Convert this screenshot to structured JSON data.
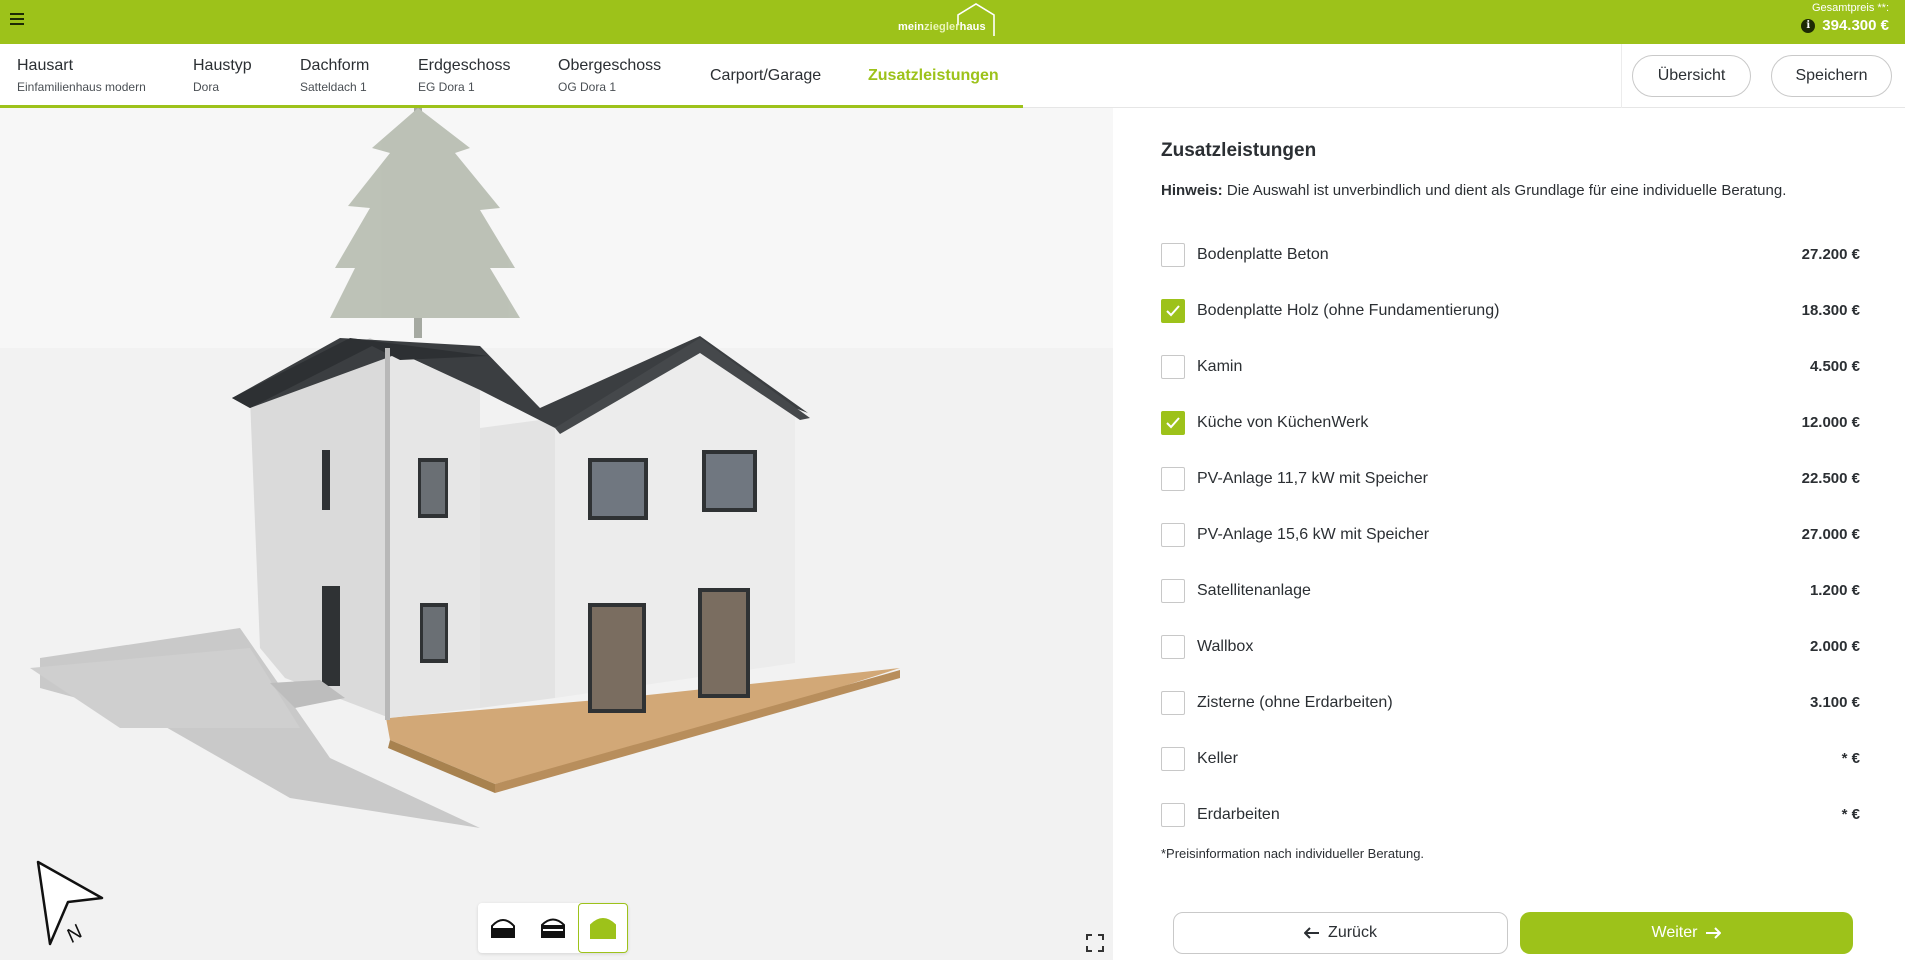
{
  "header": {
    "logo": {
      "part1": "mein",
      "part2": "ziegler",
      "part3": "haus"
    },
    "price_label": "Gesamtpreis **:",
    "price_value": "394.300 €",
    "info_icon": "info-icon",
    "menu_icon": "hamburger-menu-icon"
  },
  "nav": {
    "steps": [
      {
        "title": "Hausart",
        "sub": "Einfamilienhaus modern"
      },
      {
        "title": "Haustyp",
        "sub": "Dora"
      },
      {
        "title": "Dachform",
        "sub": "Satteldach 1"
      },
      {
        "title": "Erdgeschoss",
        "sub": "EG Dora 1"
      },
      {
        "title": "Obergeschoss",
        "sub": "OG Dora 1"
      },
      {
        "title": "Carport/Garage",
        "sub": ""
      },
      {
        "title": "Zusatzleistungen",
        "sub": "",
        "active": true
      }
    ],
    "overview_label": "Übersicht",
    "save_label": "Speichern"
  },
  "viewer": {
    "view_modes": [
      "floor-plan-view-icon",
      "section-view-icon",
      "house-3d-view-icon"
    ],
    "active_view": 2,
    "fullscreen_icon": "fullscreen-icon",
    "compass_label": "N"
  },
  "panel": {
    "title": "Zusatzleistungen",
    "hint_label": "Hinweis:",
    "hint_text": " Die Auswahl ist unverbindlich und dient als Grundlage für eine individuelle Beratung.",
    "options": [
      {
        "label": "Bodenplatte Beton",
        "price": "27.200 €",
        "checked": false
      },
      {
        "label": "Bodenplatte Holz (ohne Fundamentierung)",
        "price": "18.300 €",
        "checked": true
      },
      {
        "label": "Kamin",
        "price": "4.500 €",
        "checked": false
      },
      {
        "label": "Küche von KüchenWerk",
        "price": "12.000 €",
        "checked": true
      },
      {
        "label": "PV-Anlage 11,7 kW mit Speicher",
        "price": "22.500 €",
        "checked": false
      },
      {
        "label": "PV-Anlage 15,6 kW mit Speicher",
        "price": "27.000 €",
        "checked": false
      },
      {
        "label": "Satellitenanlage",
        "price": "1.200 €",
        "checked": false
      },
      {
        "label": "Wallbox",
        "price": "2.000 €",
        "checked": false
      },
      {
        "label": "Zisterne (ohne Erdarbeiten)",
        "price": "3.100 €",
        "checked": false
      },
      {
        "label": "Keller",
        "price": "* €",
        "checked": false
      },
      {
        "label": "Erdarbeiten",
        "price": "* €",
        "checked": false
      }
    ],
    "footnote": "*Preisinformation nach individueller Beratung.",
    "back_label": "Zurück",
    "next_label": "Weiter"
  },
  "colors": {
    "accent": "#9dc21a",
    "text": "#2b2f33",
    "viewer_bg": "#f2f2f2"
  }
}
